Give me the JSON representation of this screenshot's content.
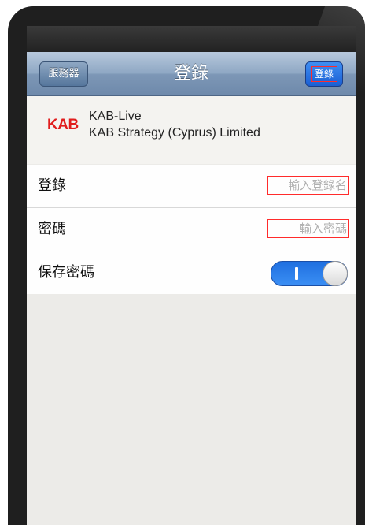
{
  "nav": {
    "back_label": "服務器",
    "title": "登錄",
    "login_label": "登錄"
  },
  "account": {
    "logo_text": "KAB",
    "name": "KAB-Live",
    "company": "KAB Strategy (Cyprus) Limited"
  },
  "form": {
    "login_label": "登錄",
    "login_placeholder": "輸入登錄名",
    "password_label": "密碼",
    "password_placeholder": "輸入密碼",
    "save_password_label": "保存密碼",
    "save_password_on": true
  },
  "colors": {
    "brand": "#e11d1d",
    "accent": "#1f6fe0"
  }
}
